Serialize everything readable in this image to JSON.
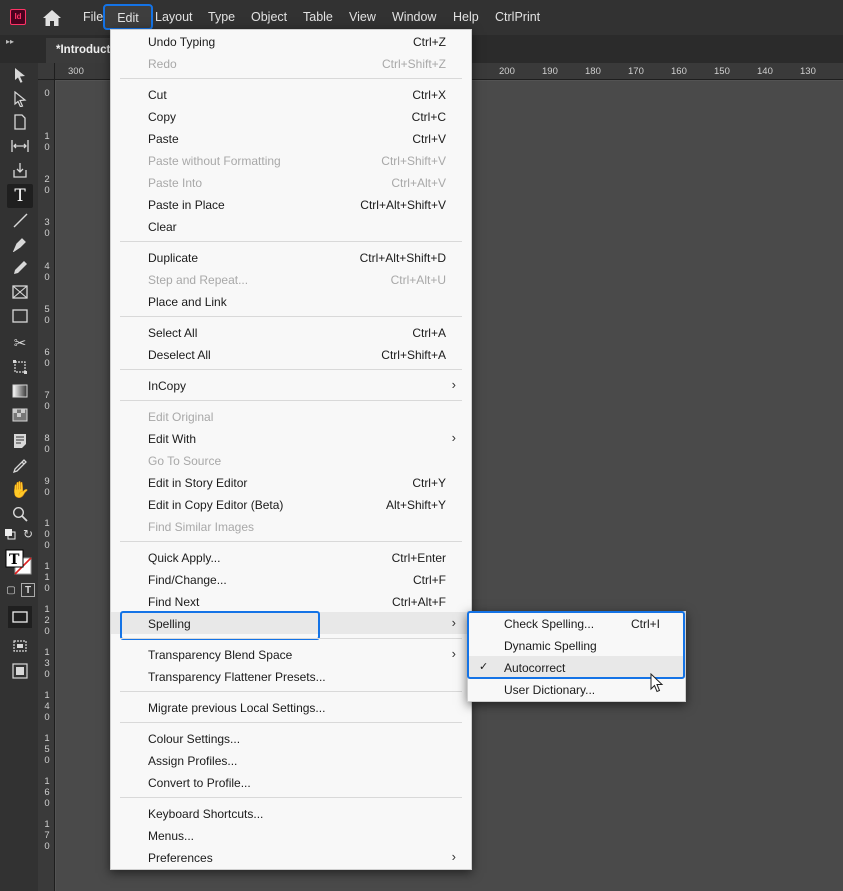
{
  "app": {
    "logo_text": "Id"
  },
  "menubar": {
    "items": [
      "File",
      "Edit",
      "Layout",
      "Type",
      "Object",
      "Table",
      "View",
      "Window",
      "Help",
      "CtrlPrint"
    ]
  },
  "document_tab": {
    "title": "*Introduction"
  },
  "ruler": {
    "horizontal": [
      "300",
      "200",
      "190",
      "180",
      "170",
      "160",
      "150",
      "140",
      "130"
    ],
    "vertical": [
      "0",
      "1 0",
      "2 0",
      "3 0",
      "4 0",
      "5 0",
      "6 0",
      "7 0",
      "8 0",
      "9 0",
      "1 0 0",
      "1 1 0",
      "1 2 0",
      "1 3 0",
      "1 4 0",
      "1 5 0",
      "1 6 0",
      "1 7 0"
    ]
  },
  "edit_menu": {
    "groups": [
      [
        {
          "label": "Undo Typing",
          "shortcut": "Ctrl+Z",
          "enabled": true
        },
        {
          "label": "Redo",
          "shortcut": "Ctrl+Shift+Z",
          "enabled": false
        }
      ],
      [
        {
          "label": "Cut",
          "shortcut": "Ctrl+X",
          "enabled": true
        },
        {
          "label": "Copy",
          "shortcut": "Ctrl+C",
          "enabled": true
        },
        {
          "label": "Paste",
          "shortcut": "Ctrl+V",
          "enabled": true
        },
        {
          "label": "Paste without Formatting",
          "shortcut": "Ctrl+Shift+V",
          "enabled": false
        },
        {
          "label": "Paste Into",
          "shortcut": "Ctrl+Alt+V",
          "enabled": false
        },
        {
          "label": "Paste in Place",
          "shortcut": "Ctrl+Alt+Shift+V",
          "enabled": true
        },
        {
          "label": "Clear",
          "shortcut": "",
          "enabled": true
        }
      ],
      [
        {
          "label": "Duplicate",
          "shortcut": "Ctrl+Alt+Shift+D",
          "enabled": true
        },
        {
          "label": "Step and Repeat...",
          "shortcut": "Ctrl+Alt+U",
          "enabled": false
        },
        {
          "label": "Place and Link",
          "shortcut": "",
          "enabled": true
        }
      ],
      [
        {
          "label": "Select All",
          "shortcut": "Ctrl+A",
          "enabled": true
        },
        {
          "label": "Deselect All",
          "shortcut": "Ctrl+Shift+A",
          "enabled": true
        }
      ],
      [
        {
          "label": "InCopy",
          "shortcut": "",
          "enabled": true,
          "submenu": true
        }
      ],
      [
        {
          "label": "Edit Original",
          "shortcut": "",
          "enabled": false
        },
        {
          "label": "Edit With",
          "shortcut": "",
          "enabled": true,
          "submenu": true
        },
        {
          "label": "Go To Source",
          "shortcut": "",
          "enabled": false
        },
        {
          "label": "Edit in Story Editor",
          "shortcut": "Ctrl+Y",
          "enabled": true
        },
        {
          "label": "Edit in Copy Editor (Beta)",
          "shortcut": "Alt+Shift+Y",
          "enabled": true
        },
        {
          "label": "Find Similar Images",
          "shortcut": "",
          "enabled": false
        }
      ],
      [
        {
          "label": "Quick Apply...",
          "shortcut": "Ctrl+Enter",
          "enabled": true
        },
        {
          "label": "Find/Change...",
          "shortcut": "Ctrl+F",
          "enabled": true
        },
        {
          "label": "Find Next",
          "shortcut": "Ctrl+Alt+F",
          "enabled": true
        },
        {
          "label": "Spelling",
          "shortcut": "",
          "enabled": true,
          "submenu": true,
          "highlighted": true
        }
      ],
      [
        {
          "label": "Transparency Blend Space",
          "shortcut": "",
          "enabled": true,
          "submenu": true
        },
        {
          "label": "Transparency Flattener Presets...",
          "shortcut": "",
          "enabled": true
        }
      ],
      [
        {
          "label": "Migrate previous Local Settings...",
          "shortcut": "",
          "enabled": true
        }
      ],
      [
        {
          "label": "Colour Settings...",
          "shortcut": "",
          "enabled": true
        },
        {
          "label": "Assign Profiles...",
          "shortcut": "",
          "enabled": true
        },
        {
          "label": "Convert to Profile...",
          "shortcut": "",
          "enabled": true
        }
      ],
      [
        {
          "label": "Keyboard Shortcuts...",
          "shortcut": "",
          "enabled": true
        },
        {
          "label": "Menus...",
          "shortcut": "",
          "enabled": true
        },
        {
          "label": "Preferences",
          "shortcut": "",
          "enabled": true,
          "submenu": true
        }
      ]
    ]
  },
  "spelling_submenu": [
    {
      "label": "Check Spelling...",
      "shortcut": "Ctrl+I",
      "checked": false
    },
    {
      "label": "Dynamic Spelling",
      "shortcut": "",
      "checked": false
    },
    {
      "label": "Autocorrect",
      "shortcut": "",
      "checked": true,
      "highlighted": true
    },
    {
      "label": "User Dictionary...",
      "shortcut": "",
      "checked": false
    }
  ],
  "colors": {
    "accent": "#1473e6",
    "app_bg": "#535353",
    "menu_bg": "#f8f8f8",
    "brand": "#ff3366"
  }
}
